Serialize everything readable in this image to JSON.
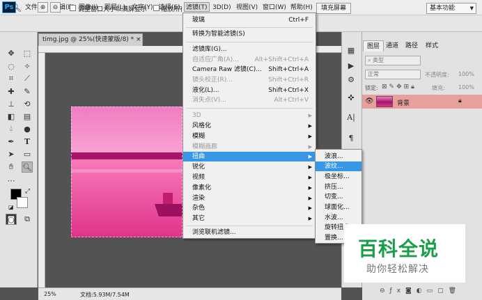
{
  "app": {
    "logo": "Ps"
  },
  "menubar": {
    "items": [
      "文件(F)",
      "编辑(E)",
      "图像(I)",
      "图层(L)",
      "文字(Y)",
      "选择(S)",
      "滤镜(T)",
      "3D(D)",
      "视图(V)",
      "窗口(W)",
      "帮助(H)"
    ],
    "active_index": 6
  },
  "window_controls": {
    "minimize": "—",
    "maximize": "☐",
    "close": "✕"
  },
  "options": {
    "resize_windows": "调整窗口大小以满屏显示",
    "zoom_all": "缩放所有",
    "fill_screen": "填充屏幕",
    "workspace": "基本功能"
  },
  "document": {
    "tab_title": "timg.jpg @ 25%(快速蒙版/8) *",
    "close": "×",
    "zoom": "25%",
    "doc_size": "文档:5.93M/7.54M"
  },
  "filter_menu": {
    "items": [
      {
        "label": "玻璃",
        "shortcut": "Ctrl+F",
        "disabled": false
      },
      {
        "label": "转换为智能滤镜(S)",
        "disabled": false
      },
      {
        "label": "滤镜库(G)...",
        "disabled": false
      },
      {
        "label": "自适应广角(A)...",
        "shortcut": "Alt+Shift+Ctrl+A",
        "disabled": true
      },
      {
        "label": "Camera Raw 滤镜(C)...",
        "shortcut": "Shift+Ctrl+A",
        "disabled": false
      },
      {
        "label": "镜头校正(R)...",
        "shortcut": "Shift+Ctrl+R",
        "disabled": true
      },
      {
        "label": "液化(L)...",
        "shortcut": "Shift+Ctrl+X",
        "disabled": false
      },
      {
        "label": "消失点(V)...",
        "shortcut": "Alt+Ctrl+V",
        "disabled": true
      },
      {
        "label": "3D",
        "disabled": true,
        "submenu": true
      },
      {
        "label": "风格化",
        "disabled": false,
        "submenu": true
      },
      {
        "label": "模糊",
        "disabled": false,
        "submenu": true
      },
      {
        "label": "模糊画廊",
        "disabled": true,
        "submenu": true
      },
      {
        "label": "扭曲",
        "disabled": false,
        "submenu": true,
        "highlighted": true
      },
      {
        "label": "锐化",
        "disabled": false,
        "submenu": true
      },
      {
        "label": "视频",
        "disabled": false,
        "submenu": true
      },
      {
        "label": "像素化",
        "disabled": false,
        "submenu": true
      },
      {
        "label": "渲染",
        "disabled": false,
        "submenu": true
      },
      {
        "label": "杂色",
        "disabled": false,
        "submenu": true
      },
      {
        "label": "其它",
        "disabled": false,
        "submenu": true
      },
      {
        "label": "浏览联机滤镜...",
        "disabled": false
      }
    ]
  },
  "distort_submenu": {
    "items": [
      "波浪...",
      "波纹...",
      "极坐标...",
      "挤压...",
      "切变...",
      "球面化...",
      "水波...",
      "旋转扭曲...",
      "置换..."
    ],
    "highlighted_index": 1
  },
  "layers_panel": {
    "tabs": [
      "图层",
      "通道",
      "路径",
      "样式"
    ],
    "active_tab": 0,
    "kind_filter": "类型",
    "blend_mode": "正常",
    "opacity_label": "不透明度:",
    "opacity_value": "100%",
    "lock_label": "锁定:",
    "fill_label": "填充:",
    "fill_value": "100%",
    "layer_name": "背景"
  },
  "watermark": {
    "title": "百科全说",
    "subtitle": "助你轻松解决"
  },
  "colors": {
    "accent": "#3797e6",
    "layer_selected": "#e7a09b",
    "watermark_green": "#1a9e4a"
  }
}
